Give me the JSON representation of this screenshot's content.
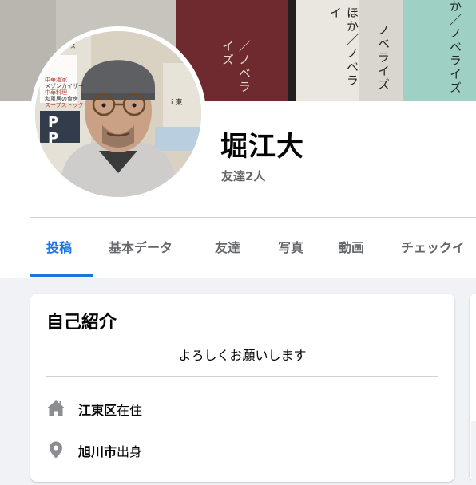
{
  "cover": {
    "book_texts": [
      "／ノベライズ",
      "ほか／ノベライ",
      "ノベライズ",
      "か／ノベライズ"
    ]
  },
  "avatar_signs": [
    "ントランス",
    "中華酒家",
    "メゾンカイザー",
    "中華料理",
    "和風居の食房",
    "スープストック",
    "P",
    "P",
    "i 東"
  ],
  "profile": {
    "name": "堀江大",
    "friends": "友達2人"
  },
  "tabs": [
    {
      "label": "投稿",
      "active": true
    },
    {
      "label": "基本データ",
      "active": false
    },
    {
      "label": "友達",
      "active": false
    },
    {
      "label": "写真",
      "active": false
    },
    {
      "label": "動画",
      "active": false
    },
    {
      "label": "チェックイ",
      "active": false
    }
  ],
  "intro": {
    "title": "自己紹介",
    "bio": "よろしくお願いします",
    "lives_place": "江東区",
    "lives_suffix": "在住",
    "from_place": "旭川市",
    "from_suffix": "出身"
  },
  "colors": {
    "accent": "#1b74e4",
    "secondary_text": "#65676b",
    "background": "#f0f2f5",
    "icon": "#8a8d91"
  }
}
